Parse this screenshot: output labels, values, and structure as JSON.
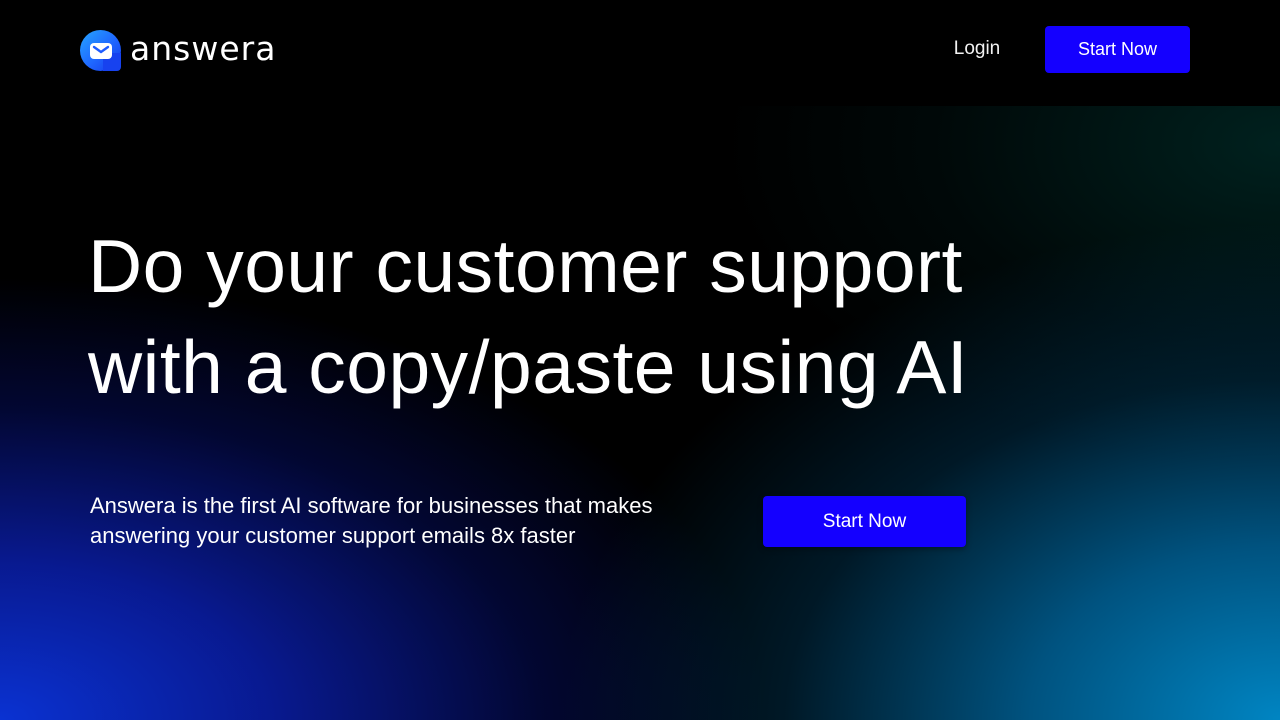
{
  "brand": {
    "name": "answera",
    "logo_icon": "envelope-chat-icon",
    "accent_color": "#1400ff"
  },
  "nav": {
    "login_label": "Login",
    "cta_label": "Start Now"
  },
  "hero": {
    "headline_line1": "Do your customer support",
    "headline_line2": "with a copy/paste using AI",
    "subtext_line1": "Answera is the first AI software for businesses that makes",
    "subtext_line2": "answering your customer support emails 8x faster",
    "cta_label": "Start Now"
  }
}
